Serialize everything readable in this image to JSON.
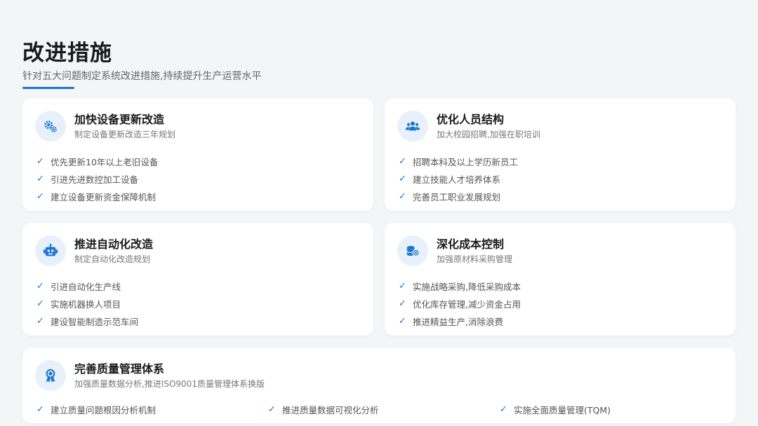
{
  "header": {
    "title": "改进措施",
    "subtitle": "针对五大问题制定系统改进措施,持续提升生产运营水平"
  },
  "colors": {
    "accent": "#1976d2",
    "icon_bg": "#e8f1fb"
  },
  "cards": [
    {
      "icon": "gears-icon",
      "title": "加快设备更新改造",
      "subtitle": "制定设备更新改造三年规划",
      "items": [
        "优先更新10年以上老旧设备",
        "引进先进数控加工设备",
        "建立设备更新资金保障机制"
      ]
    },
    {
      "icon": "users-icon",
      "title": "优化人员结构",
      "subtitle": "加大校园招聘,加强在职培训",
      "items": [
        "招聘本科及以上学历新员工",
        "建立技能人才培养体系",
        "完善员工职业发展规划"
      ]
    },
    {
      "icon": "robot-icon",
      "title": "推进自动化改造",
      "subtitle": "制定自动化改造规划",
      "items": [
        "引进自动化生产线",
        "实施机器换人项目",
        "建设智能制造示范车间"
      ]
    },
    {
      "icon": "coins-icon",
      "title": "深化成本控制",
      "subtitle": "加强原材料采购管理",
      "items": [
        "实施战略采购,降低采购成本",
        "优化库存管理,减少资金占用",
        "推进精益生产,消除浪费"
      ]
    },
    {
      "icon": "award-icon",
      "title": "完善质量管理体系",
      "subtitle": "加强质量数据分析,推进ISO9001质量管理体系换版",
      "items": [
        "建立质量问题根因分析机制",
        "推进质量数据可视化分析",
        "实施全面质量管理(TQM)"
      ]
    }
  ]
}
